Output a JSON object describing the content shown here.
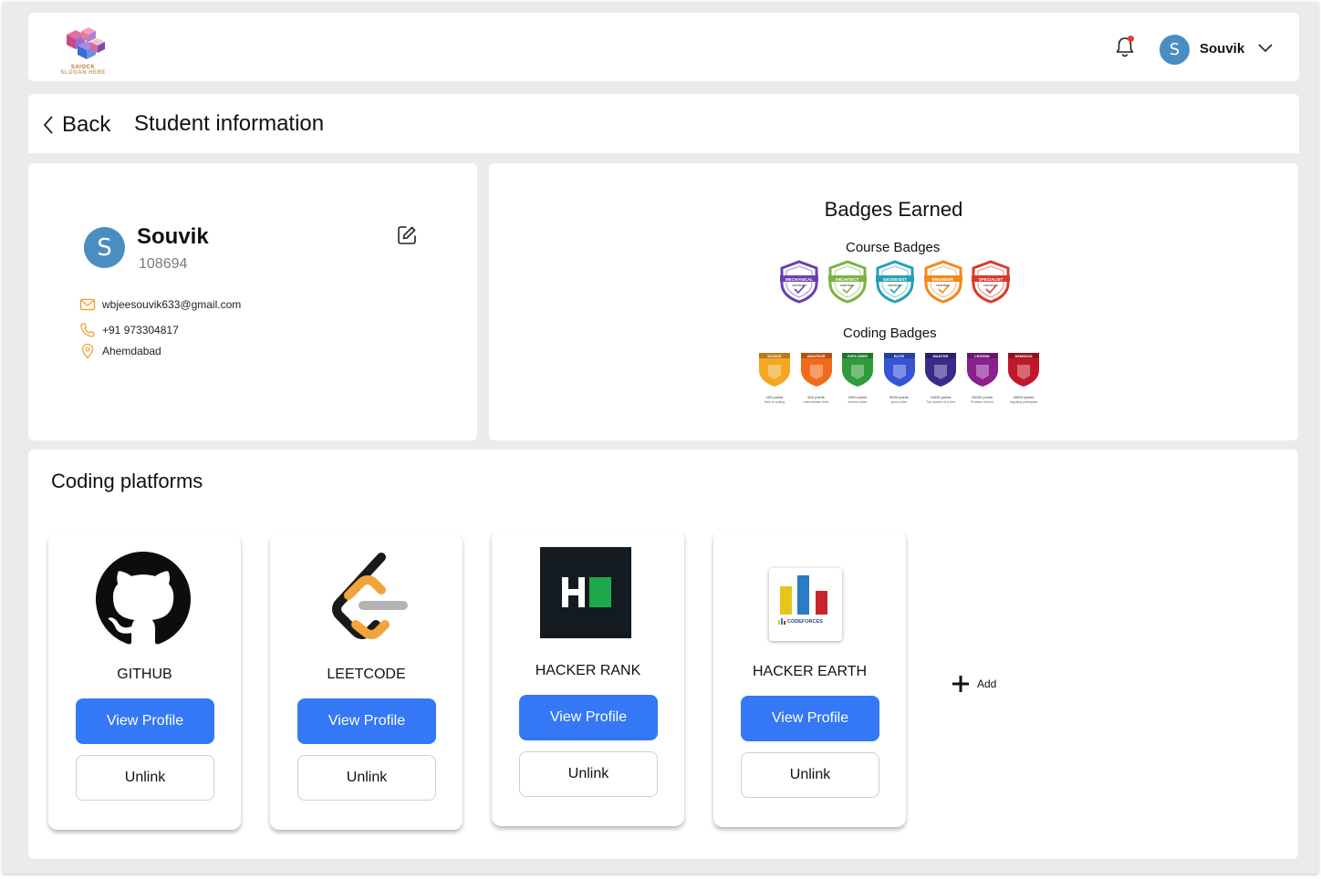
{
  "header": {
    "logo_text": "SAIOCK",
    "logo_slogan": "SLOGAN HERE",
    "user_initial": "S",
    "user_name": "Souvik",
    "notification_dot_color": "#e53935"
  },
  "titlebar": {
    "back_label": "Back",
    "title": "Student information"
  },
  "profile": {
    "initial": "S",
    "name": "Souvik",
    "id": "108694",
    "email": "wbjeesouvik633@gmail.com",
    "phone": "+91 973304817",
    "location": "Ahemdabad",
    "icon_color": "#f0a33a"
  },
  "badges": {
    "title": "Badges Earned",
    "course_title": "Course Badges",
    "coding_title": "Coding Badges",
    "course": [
      {
        "label": "MECHANICAL",
        "sub": "CERTIFIED",
        "color": "#6a3fb0"
      },
      {
        "label": "ARCHITECT",
        "sub": "CERTIFIED",
        "color": "#7cb342"
      },
      {
        "label": "GEODESIST",
        "sub": "CERTIFIED",
        "color": "#26a0b5"
      },
      {
        "label": "ENGINEER",
        "sub": "CERTIFIED",
        "color": "#f08a1c"
      },
      {
        "label": "SPECIALIST",
        "sub": "CERTIFIED",
        "color": "#d83a2e"
      }
    ],
    "coding": [
      {
        "label": "NOVICE",
        "points": "100 points",
        "desc": "New to coding",
        "color": "#f5a623"
      },
      {
        "label": "AMATEUR",
        "points": "500 points",
        "desc": "Intermediate level",
        "color": "#f26b1d"
      },
      {
        "label": "EXPLORER",
        "points": "1500 points",
        "desc": "serious coder",
        "color": "#2e9c3a"
      },
      {
        "label": "ELITE",
        "points": "5000 points",
        "desc": "good coder",
        "color": "#3555d6"
      },
      {
        "label": "MASTER",
        "points": "10000 points",
        "desc": "Top scorers of a test",
        "color": "#3a2a8a"
      },
      {
        "label": "LEGEND",
        "points": "25000 points",
        "desc": "Problem Solved",
        "color": "#8a1f8f"
      },
      {
        "label": "DEMIGOD",
        "points": "45000 points",
        "desc": "regularly participate",
        "color": "#c0182b"
      }
    ]
  },
  "platforms": {
    "title": "Coding platforms",
    "view_label": "View Profile",
    "unlink_label": "Unlink",
    "add_label": "Add",
    "accent": "#3478f6",
    "items": [
      {
        "name": "GITHUB",
        "icon": "github-icon"
      },
      {
        "name": "LEETCODE",
        "icon": "leetcode-icon"
      },
      {
        "name": "HACKER RANK",
        "icon": "hackerrank-icon"
      },
      {
        "name": "HACKER EARTH",
        "icon": "codeforces-icon",
        "logo_text": "CODEFORCES"
      }
    ]
  }
}
